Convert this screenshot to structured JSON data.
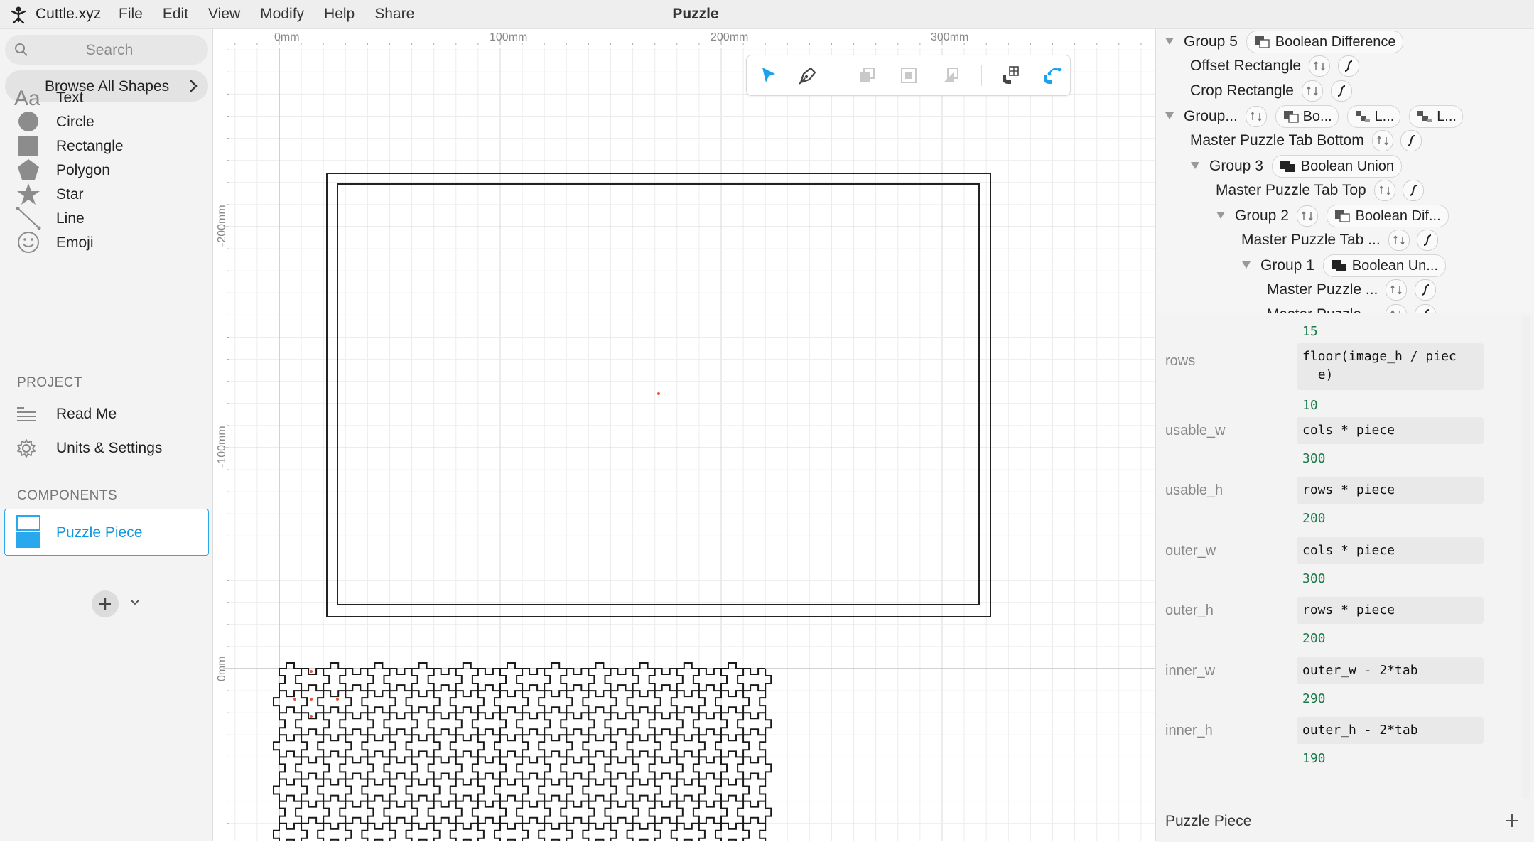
{
  "app": {
    "name": "Cuttle.xyz",
    "menus": [
      "File",
      "Edit",
      "View",
      "Modify",
      "Help",
      "Share"
    ],
    "document_title": "Puzzle",
    "accent_color": "#1aa3ec"
  },
  "sidebar": {
    "search_placeholder": "Search",
    "browse_label": "Browse All Shapes",
    "shapes": [
      {
        "label": "Text",
        "icon": "text-icon"
      },
      {
        "label": "Circle",
        "icon": "circle-icon"
      },
      {
        "label": "Rectangle",
        "icon": "rectangle-icon"
      },
      {
        "label": "Polygon",
        "icon": "polygon-icon"
      },
      {
        "label": "Star",
        "icon": "star-icon"
      },
      {
        "label": "Line",
        "icon": "line-icon"
      },
      {
        "label": "Emoji",
        "icon": "emoji-icon"
      }
    ],
    "project_heading": "PROJECT",
    "project_items": [
      {
        "label": "Read Me",
        "icon": "readme-icon"
      },
      {
        "label": "Units & Settings",
        "icon": "gear-icon"
      }
    ],
    "components_heading": "COMPONENTS",
    "components": [
      {
        "label": "Puzzle Piece",
        "selected": true
      }
    ]
  },
  "canvas": {
    "ruler_x": [
      "0mm",
      "100mm",
      "200mm",
      "300mm"
    ],
    "ruler_y": [
      "-200mm",
      "-100mm",
      "0mm"
    ],
    "toolbar": [
      {
        "name": "select-tool",
        "active": true
      },
      {
        "name": "pen-tool",
        "active": false
      },
      {
        "name": "bring-front-tool",
        "active": false
      },
      {
        "name": "arrange-tool",
        "active": false
      },
      {
        "name": "send-back-tool",
        "active": false
      },
      {
        "name": "snap-grid-tool",
        "active": false
      },
      {
        "name": "snap-curve-tool",
        "active": true
      }
    ]
  },
  "tree": {
    "rows": [
      {
        "name": "Group 5",
        "chips": [
          "Boolean Difference"
        ]
      },
      {
        "name": "Offset Rectangle",
        "chips": []
      },
      {
        "name": "Crop Rectangle",
        "chips": []
      },
      {
        "name": "Group...",
        "chips": [
          "Bo...",
          "L...",
          "L..."
        ]
      },
      {
        "name": "Master Puzzle Tab Bottom",
        "chips": []
      },
      {
        "name": "Group 3",
        "chips": [
          "Boolean Union"
        ]
      },
      {
        "name": "Master Puzzle Tab Top",
        "chips": []
      },
      {
        "name": "Group 2",
        "chips": [
          "Boolean Dif..."
        ]
      },
      {
        "name": "Master Puzzle Tab ...",
        "chips": []
      },
      {
        "name": "Group 1",
        "chips": [
          "Boolean Un..."
        ]
      },
      {
        "name": "Master Puzzle ...",
        "chips": []
      },
      {
        "name": "Master Puzzle ...",
        "chips": []
      }
    ]
  },
  "params": {
    "top_value": "15",
    "rows": [
      {
        "name": "rows",
        "expr": "floor(image_h / piec\n  e)",
        "value": "10"
      },
      {
        "name": "usable_w",
        "expr": "cols * piece",
        "value": "300"
      },
      {
        "name": "usable_h",
        "expr": "rows * piece",
        "value": "200"
      },
      {
        "name": "outer_w",
        "expr": "cols * piece",
        "value": "300"
      },
      {
        "name": "outer_h",
        "expr": "rows * piece",
        "value": "200"
      },
      {
        "name": "inner_w",
        "expr": "outer_w - 2*tab",
        "value": "290"
      },
      {
        "name": "inner_h",
        "expr": "outer_h - 2*tab",
        "value": "190"
      }
    ]
  },
  "footer": {
    "label": "Puzzle Piece"
  }
}
